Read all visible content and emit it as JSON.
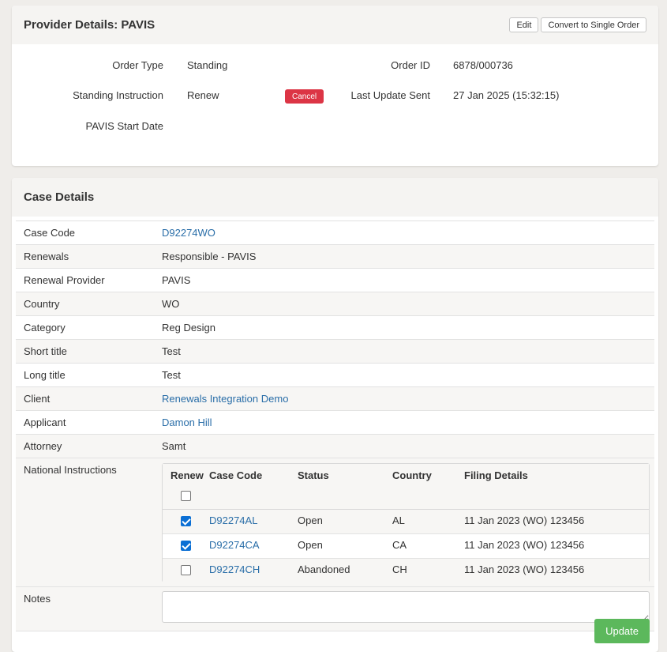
{
  "provider": {
    "title": "Provider Details: PAVIS",
    "edit_label": "Edit",
    "convert_label": "Convert to Single Order",
    "order_type_label": "Order Type",
    "order_type_value": "Standing",
    "order_id_label": "Order ID",
    "order_id_value": "6878/000736",
    "standing_label": "Standing Instruction",
    "standing_value": "Renew",
    "cancel_label": "Cancel",
    "last_update_label": "Last Update Sent",
    "last_update_value": "27 Jan 2025 (15:32:15)",
    "start_date_label": "PAVIS Start Date",
    "start_date_value": ""
  },
  "case": {
    "title": "Case Details",
    "rows": [
      {
        "label": "Case Code",
        "value": "D92274WO"
      },
      {
        "label": "Renewals",
        "value": "Responsible - PAVIS"
      },
      {
        "label": "Renewal Provider",
        "value": "PAVIS"
      },
      {
        "label": "Country",
        "value": "WO"
      },
      {
        "label": "Category",
        "value": "Reg Design"
      },
      {
        "label": "Short title",
        "value": "Test"
      },
      {
        "label": "Long title",
        "value": "Test"
      },
      {
        "label": "Client",
        "value": "Renewals Integration Demo"
      },
      {
        "label": "Applicant",
        "value": "Damon Hill"
      },
      {
        "label": "Attorney",
        "value": "Samt"
      }
    ],
    "national_label": "National Instructions",
    "national_headers": {
      "renew": "Renew",
      "case_code": "Case Code",
      "status": "Status",
      "country": "Country",
      "filing": "Filing Details"
    },
    "national_rows": [
      {
        "checked": true,
        "case_code": "D92274AL",
        "status": "Open",
        "country": "AL",
        "filing": "11 Jan 2023 (WO) 123456"
      },
      {
        "checked": true,
        "case_code": "D92274CA",
        "status": "Open",
        "country": "CA",
        "filing": "11 Jan 2023 (WO) 123456"
      },
      {
        "checked": false,
        "case_code": "D92274CH",
        "status": "Abandoned",
        "country": "CH",
        "filing": "11 Jan 2023 (WO) 123456"
      }
    ],
    "notes_label": "Notes",
    "notes_value": "",
    "update_label": "Update"
  },
  "colors": {
    "accent_link": "#2a6ea8",
    "cancel": "#dc3545",
    "update": "#5cb85c",
    "checkbox": "#0b6fd4"
  }
}
